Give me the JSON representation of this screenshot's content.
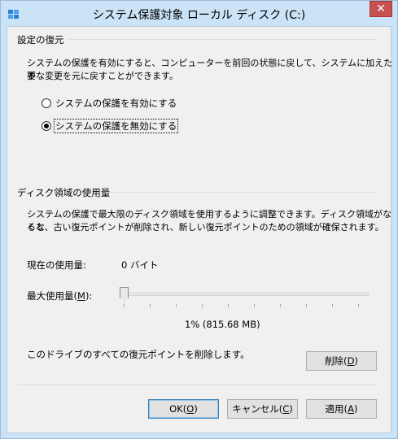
{
  "window": {
    "title": "システム保護対象 ローカル ディスク (C:)",
    "close_label": "✕"
  },
  "restore": {
    "group_title": "設定の復元",
    "description_line1": "システムの保護を有効にすると、コンピューターを前回の状態に戻して、システムに加えた不",
    "description_line2": "要な変更を元に戻すことができます。",
    "options": [
      {
        "label": "システムの保護を有効にする",
        "selected": false
      },
      {
        "label": "システムの保護を無効にする",
        "selected": true
      }
    ]
  },
  "disk": {
    "group_title": "ディスク領域の使用量",
    "description_line1": "システムの保護で最大限のディスク領域を使用するように調整できます。ディスク領域がなくな",
    "description_line2": "ると、古い復元ポイントが削除され、新しい復元ポイントのための領域が確保されます。",
    "current_usage_label": "現在の使用量:",
    "current_usage_value": "0 バイト",
    "max_usage_label_prefix": "最大使用量(",
    "max_usage_accel": "M",
    "max_usage_label_suffix": "):",
    "slider_value_percent": 1,
    "slider_readout": "1% (815.68 MB)",
    "delete_text": "このドライブのすべての復元ポイントを削除します。",
    "delete_button": {
      "prefix": "削除(",
      "accel": "D",
      "suffix": ")"
    }
  },
  "footer": {
    "ok": {
      "prefix": "OK(",
      "accel": "O",
      "suffix": ")"
    },
    "cancel": {
      "prefix": "キャンセル(",
      "accel": "C",
      "suffix": ")"
    },
    "apply": {
      "prefix": "適用(",
      "accel": "A",
      "suffix": ")"
    }
  }
}
